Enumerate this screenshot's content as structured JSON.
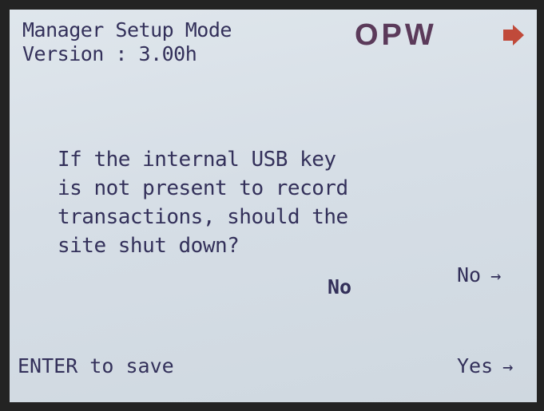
{
  "header": {
    "mode": "Manager Setup Mode",
    "version": "Version : 3.00h",
    "logo_text": "OPW"
  },
  "prompt": {
    "lines": [
      "If the internal USB key",
      "is not present to record",
      "transactions, should the",
      "site shut down?"
    ]
  },
  "current_value": "No",
  "options": {
    "no_label": "No",
    "yes_label": "Yes",
    "arrow": "→"
  },
  "footer": {
    "enter_hint": "ENTER to save"
  },
  "colors": {
    "text": "#33305a",
    "logo": "#5b3a5a",
    "screen_bg": "#d6dee6"
  }
}
